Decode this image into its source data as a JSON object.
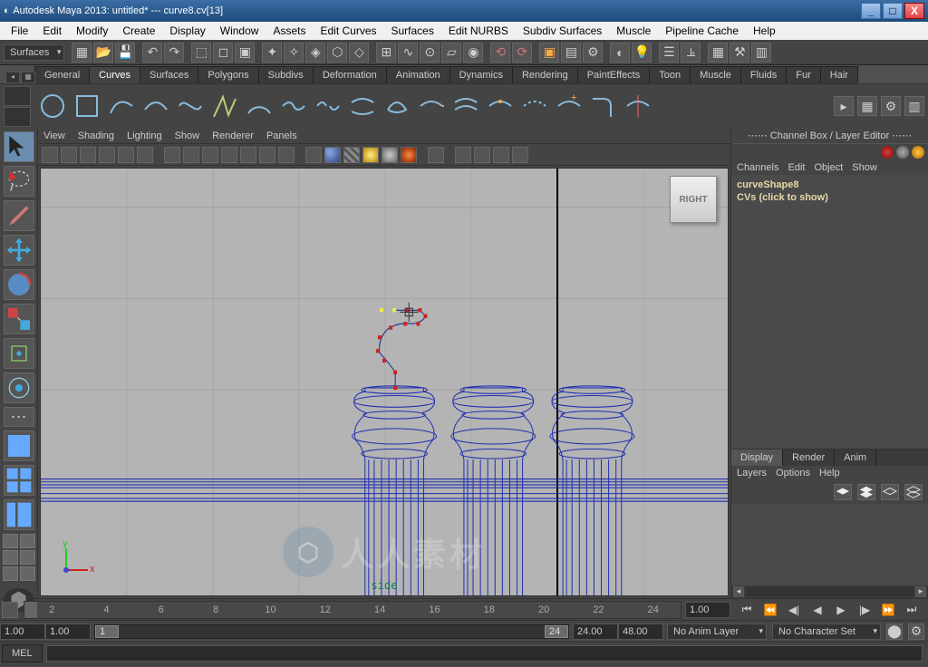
{
  "window": {
    "title": "Autodesk Maya 2013: untitled*  ---  curve8.cv[13]",
    "minimize": "_",
    "maximize": "□",
    "close": "X"
  },
  "main_menu": [
    "File",
    "Edit",
    "Modify",
    "Create",
    "Display",
    "Window",
    "Assets",
    "Edit Curves",
    "Surfaces",
    "Edit NURBS",
    "Subdiv Surfaces",
    "Muscle",
    "Pipeline Cache",
    "Help"
  ],
  "mode_dropdown": "Surfaces",
  "shelf_tabs": [
    "General",
    "Curves",
    "Surfaces",
    "Polygons",
    "Subdivs",
    "Deformation",
    "Animation",
    "Dynamics",
    "Rendering",
    "PaintEffects",
    "Toon",
    "Muscle",
    "Fluids",
    "Fur",
    "Hair"
  ],
  "shelf_active": "Curves",
  "view_menu": [
    "View",
    "Shading",
    "Lighting",
    "Show",
    "Renderer",
    "Panels"
  ],
  "viewcube": "RIGHT",
  "view_label": "side",
  "channel_panel": {
    "title": "Channel Box / Layer Editor",
    "menus": [
      "Channels",
      "Edit",
      "Object",
      "Show"
    ],
    "node_name": "curveShape8",
    "cvs_line": "CVs (click to show)"
  },
  "layer_panel": {
    "tabs": [
      "Display",
      "Render",
      "Anim"
    ],
    "active": "Display",
    "menus": [
      "Layers",
      "Options",
      "Help"
    ]
  },
  "timeline": {
    "numbers": [
      "2",
      "4",
      "6",
      "8",
      "10",
      "12",
      "14",
      "16",
      "18",
      "20",
      "22",
      "24"
    ],
    "current": "1.00"
  },
  "range": {
    "start_out": "1.00",
    "start_in": "1.00",
    "cur1": "1",
    "end_in": "24",
    "end_out": "24.00",
    "end_max": "48.00"
  },
  "anim_layer": "No Anim Layer",
  "char_set": "No Character Set",
  "cmdline_label": "MEL",
  "watermark": "人人素材"
}
